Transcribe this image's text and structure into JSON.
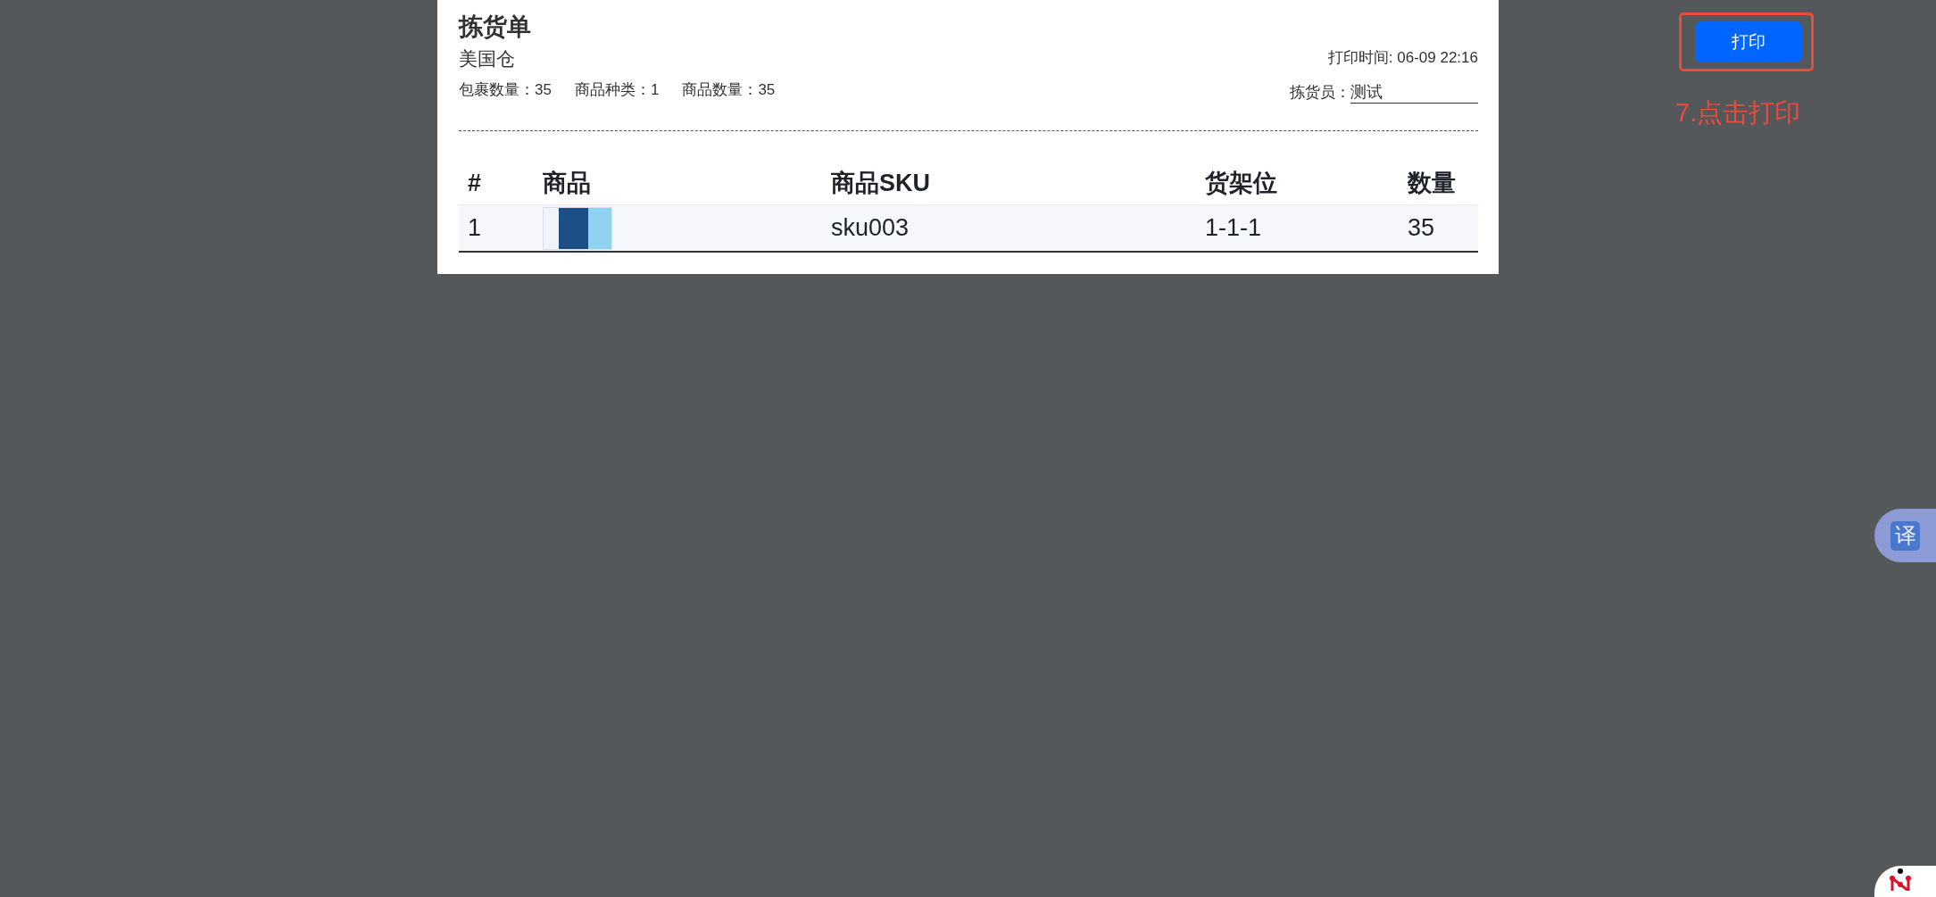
{
  "document": {
    "title": "拣货单",
    "warehouse": "美国仓",
    "print_time": "打印时间: 06-09 22:16",
    "stats": [
      "包裹数量：35",
      "商品种类：1",
      "商品数量：35"
    ],
    "picker": {
      "label": "拣货员：",
      "value": "测试"
    },
    "table": {
      "columns": [
        "#",
        "商品",
        "商品SKU",
        "货架位",
        "数量"
      ],
      "rows": [
        {
          "index": "1",
          "sku": "sku003",
          "location": "1-1-1",
          "quantity": "35"
        }
      ]
    }
  },
  "print_button": {
    "label": "打印",
    "highlighted": true
  },
  "annotation": "7.点击打印",
  "translate_button": {
    "label": "译"
  }
}
